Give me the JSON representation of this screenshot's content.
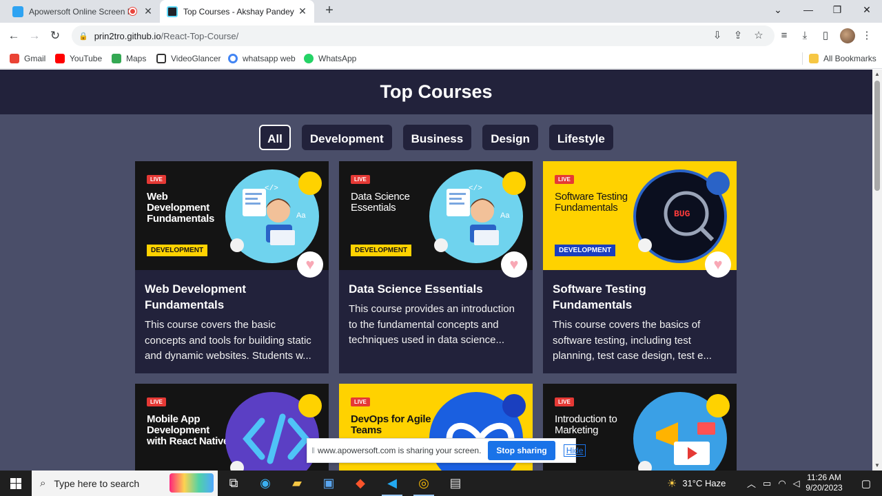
{
  "browser": {
    "tabs": [
      {
        "title": "Apowersoft Online Screen Re",
        "favicon_color": "#2ea3f2"
      },
      {
        "title": "Top Courses - Akshay Pandey",
        "favicon_color": "#61dafb"
      }
    ],
    "url_host": "prin2tro.github.io",
    "url_path": "/React-Top-Course/",
    "bookmarks": [
      {
        "label": "Gmail",
        "color": "#ea4335"
      },
      {
        "label": "YouTube",
        "color": "#ff0000"
      },
      {
        "label": "Maps",
        "color": "#34a853"
      },
      {
        "label": "VideoGlancer",
        "color": "#333333"
      },
      {
        "label": "whatsapp web",
        "color": "#4285f4"
      },
      {
        "label": "WhatsApp",
        "color": "#25d366"
      }
    ],
    "all_bookmarks": "All Bookmarks"
  },
  "page": {
    "title": "Top Courses",
    "filters": [
      {
        "label": "All",
        "selected": true
      },
      {
        "label": "Development",
        "selected": false
      },
      {
        "label": "Business",
        "selected": false
      },
      {
        "label": "Design",
        "selected": false
      },
      {
        "label": "Lifestyle",
        "selected": false
      }
    ],
    "courses": [
      {
        "thumb_title": "Web Development Fundamentals",
        "tag": "DEVELOPMENT",
        "title": "Web Development Fundamentals",
        "desc": "This course covers the basic concepts and tools for building static and dynamic websites. Students w...",
        "theme": "dark"
      },
      {
        "thumb_title": "Data Science Essentials",
        "tag": "DEVELOPMENT",
        "title": "Data Science Essentials",
        "desc": "This course provides an introduction to the fundamental concepts and techniques used in data science...",
        "theme": "dark"
      },
      {
        "thumb_title": "Software Testing Fundamentals",
        "tag": "DEVELOPMENT",
        "title": "Software Testing Fundamentals",
        "desc": "This course covers the basics of software testing, including test planning, test case design, test e...",
        "theme": "yellow"
      },
      {
        "thumb_title": "Mobile App Development with React Native",
        "tag": "",
        "title": "",
        "desc": "",
        "theme": "dark"
      },
      {
        "thumb_title": "DevOps for Agile Teams",
        "tag": "",
        "title": "",
        "desc": "",
        "theme": "yellow"
      },
      {
        "thumb_title": "Introduction to Marketing",
        "tag": "",
        "title": "",
        "desc": "",
        "theme": "dark"
      }
    ],
    "live_label": "LIVE",
    "thumb_bug_text": "BUG"
  },
  "sharing_bar": {
    "message": "www.apowersoft.com is sharing your screen.",
    "stop_label": "Stop sharing",
    "hide_label": "Hide"
  },
  "taskbar": {
    "search_placeholder": "Type here to search",
    "weather": "31°C  Haze",
    "time": "11:26 AM",
    "date": "9/20/2023"
  }
}
